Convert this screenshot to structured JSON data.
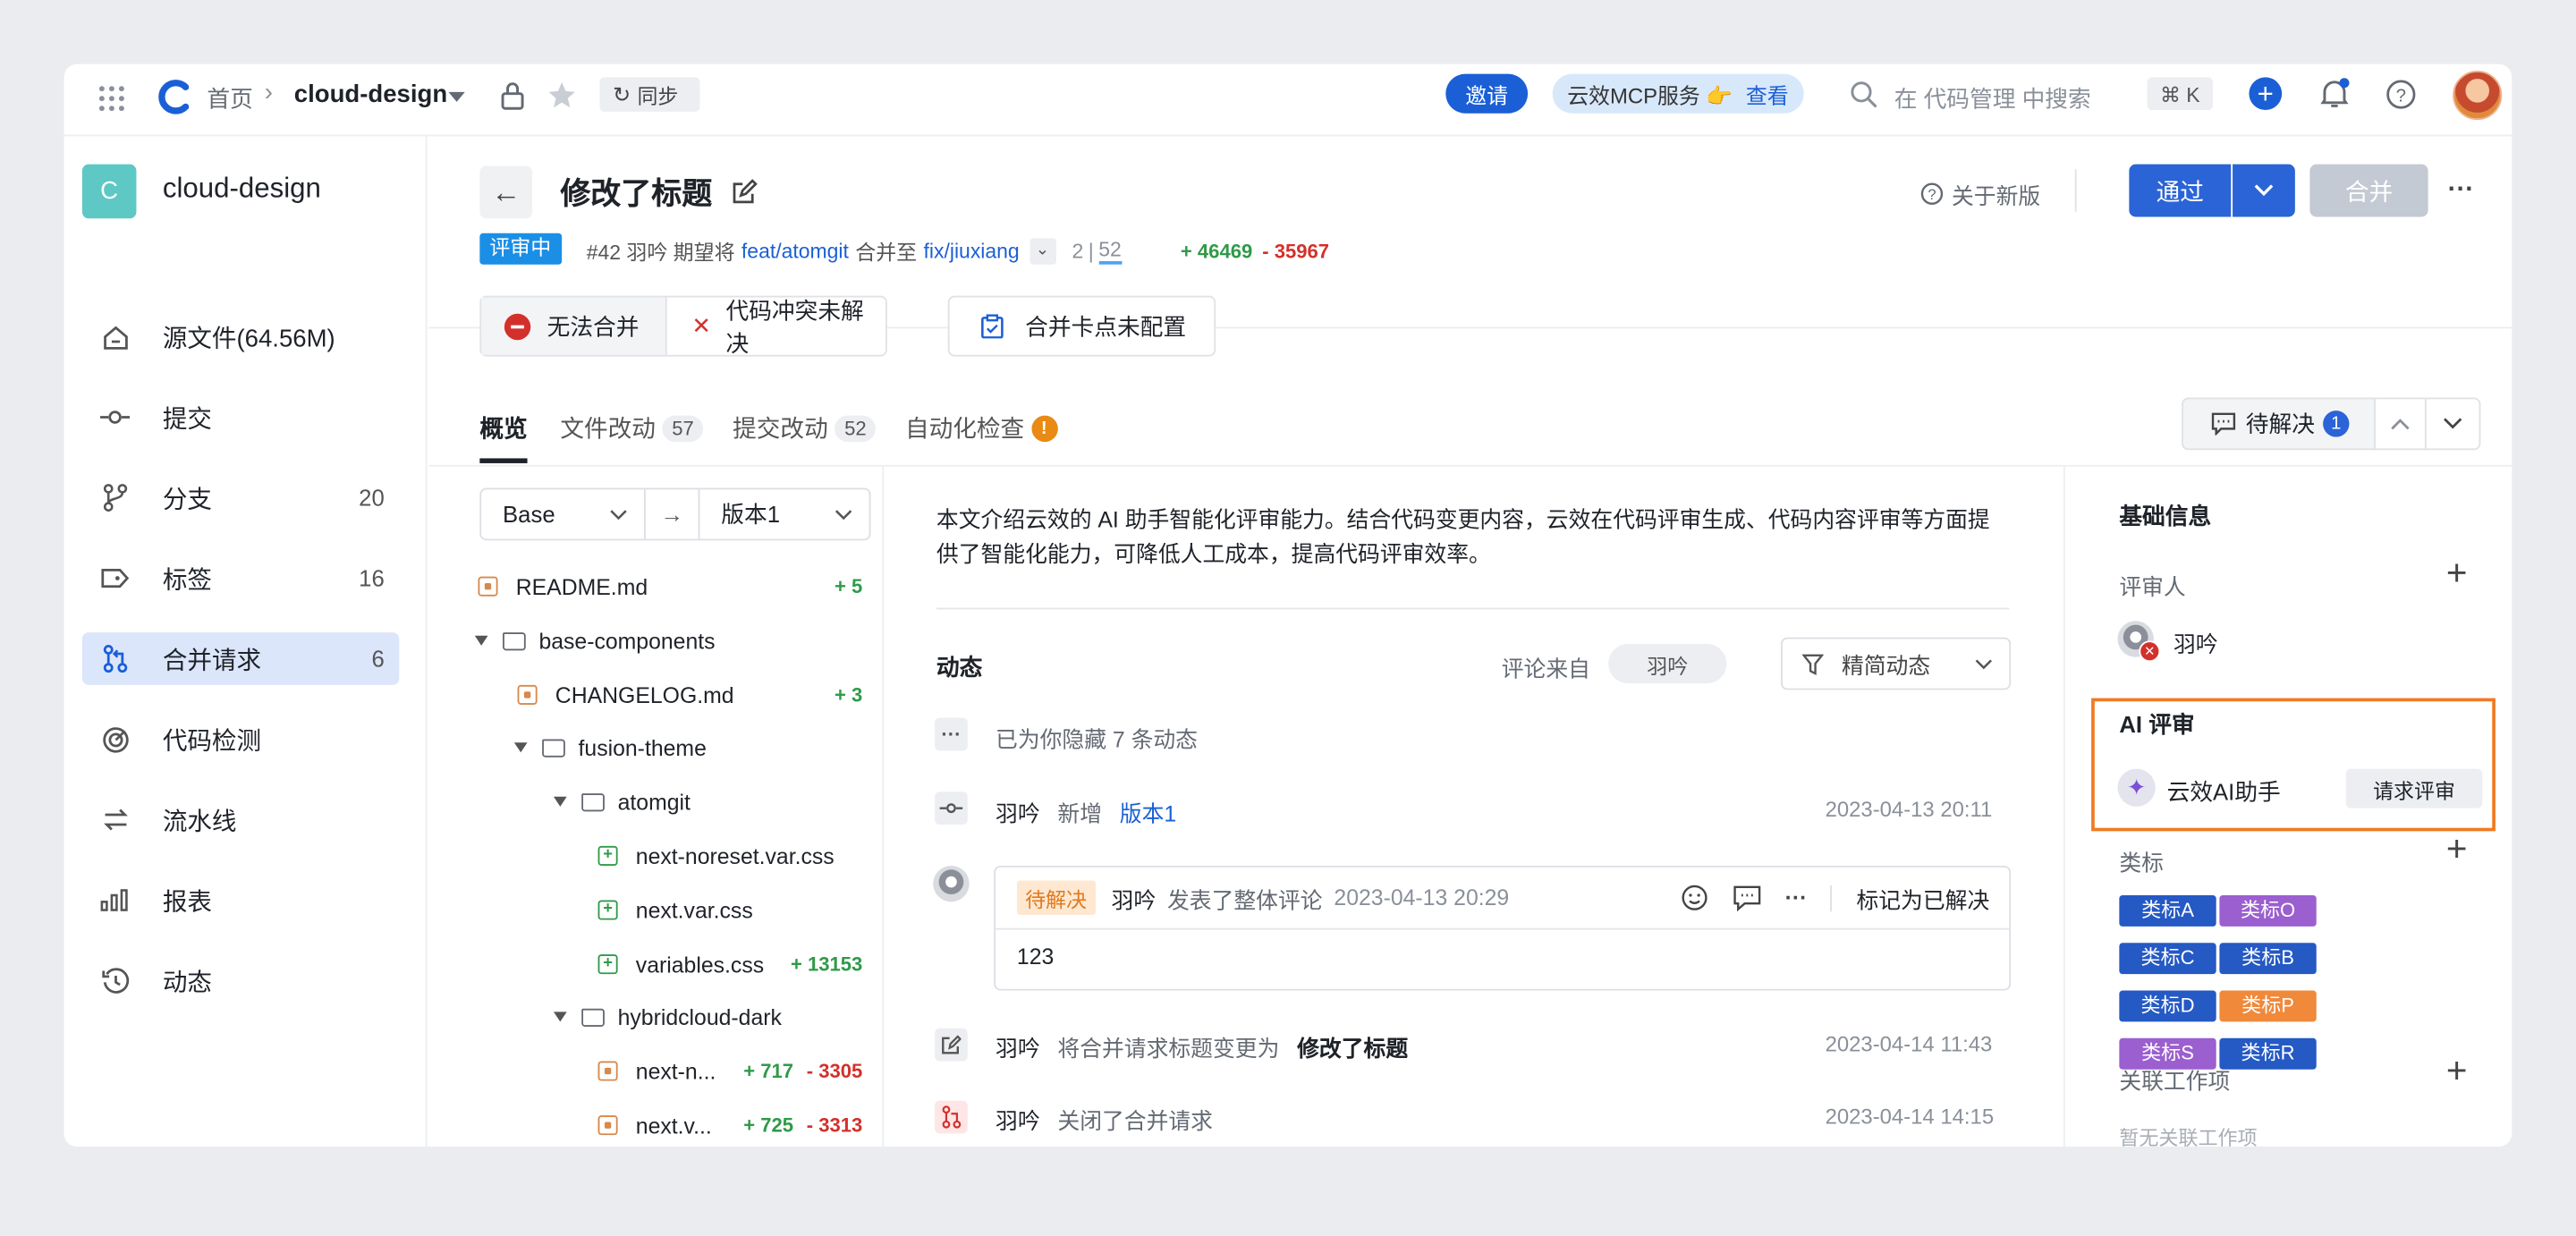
{
  "topbar": {
    "breadcrumb_home": "首页",
    "repo_name": "cloud-design",
    "sync_label": "同步",
    "invite_label": "邀请",
    "mcp_label": "云效MCP服务 👉",
    "mcp_view": "查看",
    "search_placeholder": "在 代码管理 中搜索",
    "shortcut": "⌘ K"
  },
  "sidebar": {
    "repo_initial": "C",
    "repo_name": "cloud-design",
    "items": [
      {
        "label": "源文件(64.56M)",
        "count": "",
        "icon": "home-icon"
      },
      {
        "label": "提交",
        "count": "",
        "icon": "commit-icon"
      },
      {
        "label": "分支",
        "count": "20",
        "icon": "branch-icon"
      },
      {
        "label": "标签",
        "count": "16",
        "icon": "tag-icon"
      },
      {
        "label": "合并请求",
        "count": "6",
        "icon": "merge-request-icon",
        "active": true
      },
      {
        "label": "代码检测",
        "count": "",
        "icon": "scan-icon"
      },
      {
        "label": "流水线",
        "count": "",
        "icon": "pipeline-icon"
      },
      {
        "label": "报表",
        "count": "",
        "icon": "chart-icon"
      },
      {
        "label": "动态",
        "count": "",
        "icon": "history-icon"
      }
    ]
  },
  "header": {
    "title": "修改了标题",
    "status": "评审中",
    "desc_prefix": "#42 羽吟 期望将",
    "source_branch": "feat/atomgit",
    "merge_to": "合并至",
    "target_branch": "fix/jiuxiang",
    "count_a": "2",
    "count_b": "52",
    "additions": "+ 46469",
    "deletions": "- 35967",
    "about_new": "关于新版",
    "approve": "通过",
    "merge": "合并"
  },
  "alerts": {
    "cannot_merge": "无法合并",
    "conflict": "代码冲突未解决",
    "checkpoint": "合并卡点未配置"
  },
  "tabs": [
    {
      "label": "概览",
      "badge": ""
    },
    {
      "label": "文件改动",
      "badge": "57"
    },
    {
      "label": "提交改动",
      "badge": "52"
    },
    {
      "label": "自动化检查",
      "badge": "!"
    }
  ],
  "pending": {
    "label": "待解决",
    "count": "1"
  },
  "version_select": {
    "base": "Base",
    "target": "版本1"
  },
  "files": [
    {
      "name": "README.md",
      "type": "modified",
      "add": "+ 5",
      "del": ""
    },
    {
      "name": "base-components",
      "type": "folder",
      "add": "",
      "del": ""
    },
    {
      "name": "CHANGELOG.md",
      "type": "modified",
      "add": "+ 3",
      "del": ""
    },
    {
      "name": "fusion-theme",
      "type": "folder",
      "add": "",
      "del": ""
    },
    {
      "name": "atomgit",
      "type": "folder",
      "add": "",
      "del": ""
    },
    {
      "name": "next-noreset.var.css",
      "type": "added",
      "add": "",
      "del": ""
    },
    {
      "name": "next.var.css",
      "type": "added",
      "add": "",
      "del": ""
    },
    {
      "name": "variables.css",
      "type": "added",
      "add": "+ 13153",
      "del": ""
    },
    {
      "name": "hybridcloud-dark",
      "type": "folder",
      "add": "",
      "del": ""
    },
    {
      "name": "next-n...",
      "type": "modified",
      "add": "+ 717",
      "del": "- 3305"
    },
    {
      "name": "next.v...",
      "type": "modified",
      "add": "+ 725",
      "del": "- 3313"
    }
  ],
  "description": "本文介绍云效的 AI 助手智能化评审能力。结合代码变更内容，云效在代码评审生成、代码内容评审等方面提供了智能化能力，可降低人工成本，提高代码评审效率。",
  "activity": {
    "title": "动态",
    "comment_from": "评论来自",
    "comment_user": "羽吟",
    "filter": "精简动态",
    "hidden": "已为你隐藏 7 条动态",
    "events": [
      {
        "user": "羽吟",
        "action": "新增",
        "target": "版本1",
        "time": "2023-04-13 20:11"
      },
      {
        "user": "羽吟",
        "action": "将合并请求标题变更为",
        "target": "修改了标题",
        "time": "2023-04-14 11:43"
      },
      {
        "user": "羽吟",
        "action": "关闭了合并请求",
        "target": "",
        "time": "2023-04-14 14:15"
      }
    ],
    "comment": {
      "status": "待解决",
      "user": "羽吟",
      "action": "发表了整体评论",
      "time": "2023-04-13 20:29",
      "resolve": "标记为已解决",
      "body": "123"
    }
  },
  "info": {
    "title": "基础信息",
    "reviewers_label": "评审人",
    "reviewer": "羽吟",
    "ai_title": "AI 评审",
    "ai_name": "云效AI助手",
    "ai_request": "请求评审",
    "labels_title": "类标",
    "labels": [
      {
        "text": "类标A",
        "color": "#2559c4"
      },
      {
        "text": "类标O",
        "color": "#9b5fcf"
      },
      {
        "text": "类标C",
        "color": "#2559c4"
      },
      {
        "text": "类标B",
        "color": "#2559c4"
      },
      {
        "text": "类标D",
        "color": "#2559c4"
      },
      {
        "text": "类标P",
        "color": "#f0893a"
      },
      {
        "text": "类标S",
        "color": "#9b5fcf"
      },
      {
        "text": "类标R",
        "color": "#2559c4"
      }
    ],
    "workitems_title": "关联工作项",
    "workitems_empty": "暂无关联工作项"
  },
  "colors": {
    "primary": "#1b5fd6",
    "highlight_border": "#f07a22"
  }
}
